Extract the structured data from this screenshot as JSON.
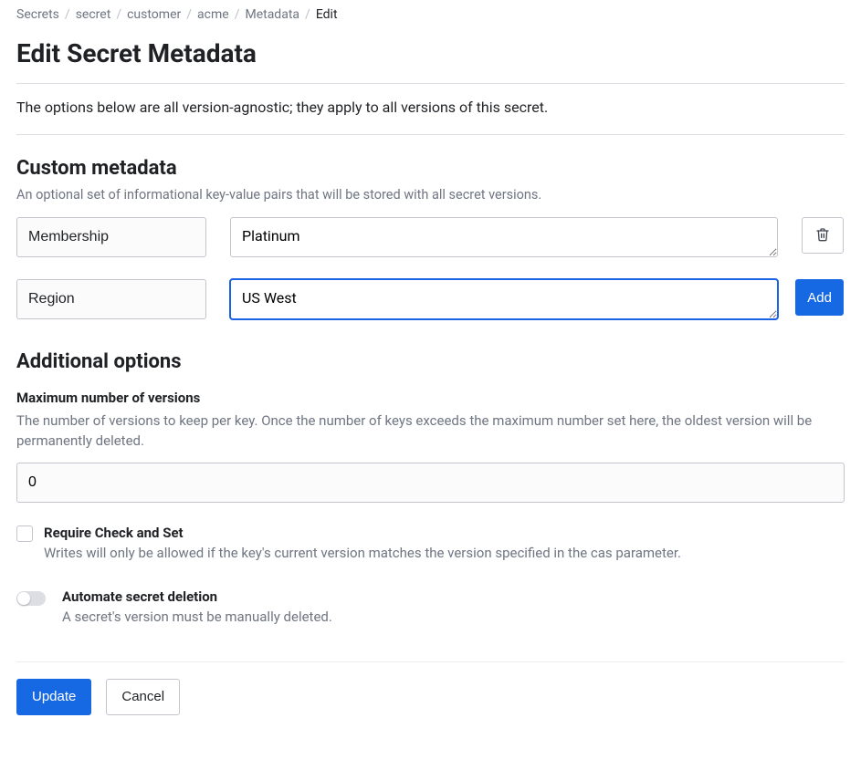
{
  "breadcrumb": [
    "Secrets",
    "secret",
    "customer",
    "acme",
    "Metadata",
    "Edit"
  ],
  "page_title": "Edit Secret Metadata",
  "intro": "The options below are all version-agnostic; they apply to all versions of this secret.",
  "custom_metadata": {
    "title": "Custom metadata",
    "subtext": "An optional set of informational key-value pairs that will be stored with all secret versions.",
    "rows": [
      {
        "key": "Membership",
        "value": "Platinum"
      },
      {
        "key": "Region",
        "value": "US West"
      }
    ],
    "add_label": "Add"
  },
  "additional_options": {
    "title": "Additional options",
    "max_versions": {
      "label": "Maximum number of versions",
      "desc": "The number of versions to keep per key. Once the number of keys exceeds the maximum number set here, the oldest version will be permanently deleted.",
      "value": "0"
    },
    "require_cas": {
      "label": "Require Check and Set",
      "desc": "Writes will only be allowed if the key's current version matches the version specified in the cas parameter."
    },
    "auto_delete": {
      "label": "Automate secret deletion",
      "desc": "A secret's version must be manually deleted."
    }
  },
  "actions": {
    "update": "Update",
    "cancel": "Cancel"
  }
}
